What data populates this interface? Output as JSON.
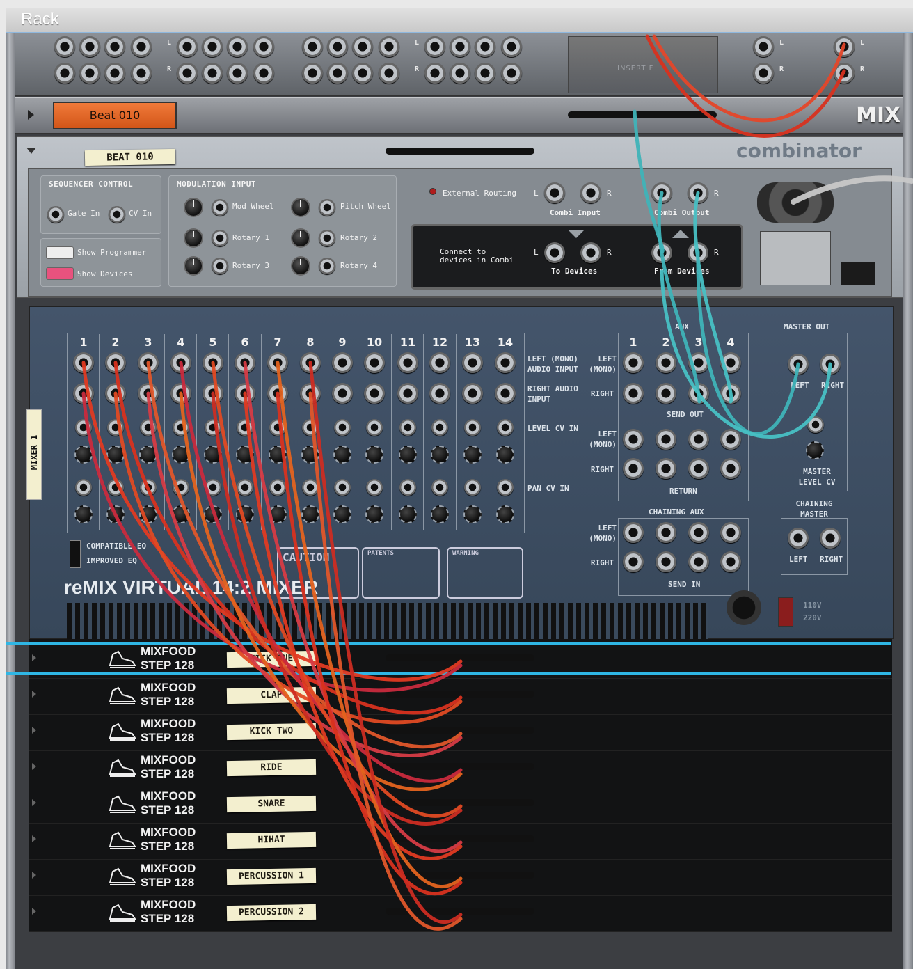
{
  "window": {
    "title": "Rack"
  },
  "hardware": {
    "insert_label": "INSERT F",
    "ch_l": "L",
    "ch_r": "R"
  },
  "mix_device": {
    "patch_name": "Beat 010",
    "device_label": "MIX"
  },
  "combinator": {
    "brand": "combinator",
    "name_tape": "BEAT 010",
    "sequencer_control": {
      "title": "SEQUENCER CONTROL",
      "gate_in": "Gate In",
      "cv_in": "CV In"
    },
    "show_programmer": "Show Programmer",
    "show_devices": "Show Devices",
    "modulation_input": {
      "title": "MODULATION INPUT",
      "mod_wheel": "Mod Wheel",
      "pitch_wheel": "Pitch Wheel",
      "rotary1": "Rotary 1",
      "rotary2": "Rotary 2",
      "rotary3": "Rotary 3",
      "rotary4": "Rotary 4"
    },
    "external_routing": "External Routing",
    "combi_input": "Combi Input",
    "combi_output": "Combi Output",
    "connect_text": "Connect to devices in Combi",
    "to_devices": "To Devices",
    "from_devices": "From Devices",
    "l": "L",
    "r": "R"
  },
  "mixer": {
    "side_tab": "MIXER 1",
    "channels": [
      "1",
      "2",
      "3",
      "4",
      "5",
      "6",
      "7",
      "8",
      "9",
      "10",
      "11",
      "12",
      "13",
      "14"
    ],
    "left_mono_audio_input": "LEFT (MONO) AUDIO INPUT",
    "right_audio_input": "RIGHT AUDIO INPUT",
    "level_cv_in": "LEVEL CV IN",
    "pan_cv_in": "PAN CV IN",
    "aux_title": "AUX",
    "aux_channels": [
      "1",
      "2",
      "3",
      "4"
    ],
    "left_mono": "LEFT (MONO)",
    "left": "LEFT",
    "right": "RIGHT",
    "send_out": "SEND OUT",
    "return": "RETURN",
    "chaining_aux": "CHAINING AUX",
    "send_in": "SEND IN",
    "master_out": "MASTER OUT",
    "master_level_cv": "MASTER LEVEL CV",
    "chaining_master": "CHAINING MASTER",
    "compatible_eq": "COMPATIBLE EQ",
    "improved_eq": "IMPROVED EQ",
    "brand": "reMIX VIRTUAL 14:2 MIXER",
    "caution": "CAUTION",
    "patents_title": "PATENTS",
    "warning_title": "WARNING",
    "voltage_115": "110V",
    "voltage_220": "220V"
  },
  "drum_devices": [
    {
      "brand_line1": "MIXFOOD",
      "brand_line2": "STEP 128",
      "name": "KICK ONE"
    },
    {
      "brand_line1": "MIXFOOD",
      "brand_line2": "STEP 128",
      "name": "CLAP"
    },
    {
      "brand_line1": "MIXFOOD",
      "brand_line2": "STEP 128",
      "name": "KICK TWO"
    },
    {
      "brand_line1": "MIXFOOD",
      "brand_line2": "STEP 128",
      "name": "RIDE"
    },
    {
      "brand_line1": "MIXFOOD",
      "brand_line2": "STEP 128",
      "name": "SNARE"
    },
    {
      "brand_line1": "MIXFOOD",
      "brand_line2": "STEP 128",
      "name": "HIHAT"
    },
    {
      "brand_line1": "MIXFOOD",
      "brand_line2": "STEP 128",
      "name": "PERCUSSION 1"
    },
    {
      "brand_line1": "MIXFOOD",
      "brand_line2": "STEP 128",
      "name": "PERCUSSION 2"
    }
  ],
  "colors": {
    "accent": "#2fb6e4",
    "patch_orange": "#e4631f",
    "cable_red": "#d8321f",
    "cable_teal": "#3fb3b8"
  }
}
